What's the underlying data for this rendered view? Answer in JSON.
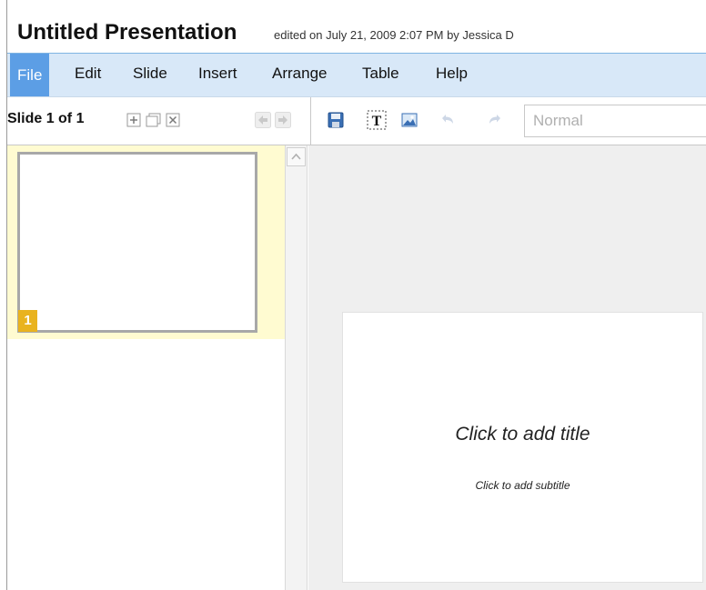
{
  "title_bar": {
    "title": "Untitled Presentation",
    "meta": "edited on July 21, 2009 2:07 PM by Jessica D"
  },
  "menu": {
    "items": [
      {
        "label": "File",
        "active": true
      },
      {
        "label": "Edit"
      },
      {
        "label": "Slide"
      },
      {
        "label": "Insert"
      },
      {
        "label": "Arrange"
      },
      {
        "label": "Table"
      },
      {
        "label": "Help"
      }
    ]
  },
  "toolbar": {
    "slide_count_prefix": "Slide",
    "slide_count_value": "1 of 1",
    "icons": [
      "add-slide-icon",
      "duplicate-slide-icon",
      "delete-slide-icon",
      "move-up-icon",
      "move-down-icon",
      "save-icon",
      "text-box-icon",
      "image-icon",
      "undo-icon",
      "redo-icon"
    ],
    "style_value": "Normal"
  },
  "sidebar": {
    "slides": [
      {
        "number": "1"
      }
    ]
  },
  "slide": {
    "title_placeholder": "Click to add title",
    "subtitle_placeholder": "Click to add subtitle"
  },
  "colors": {
    "menu_bg": "#d8e8f8",
    "menu_active": "#5c9ee5",
    "thumb_selected_bg": "#fffbd1",
    "slide_number_badge": "#e9b31f"
  }
}
